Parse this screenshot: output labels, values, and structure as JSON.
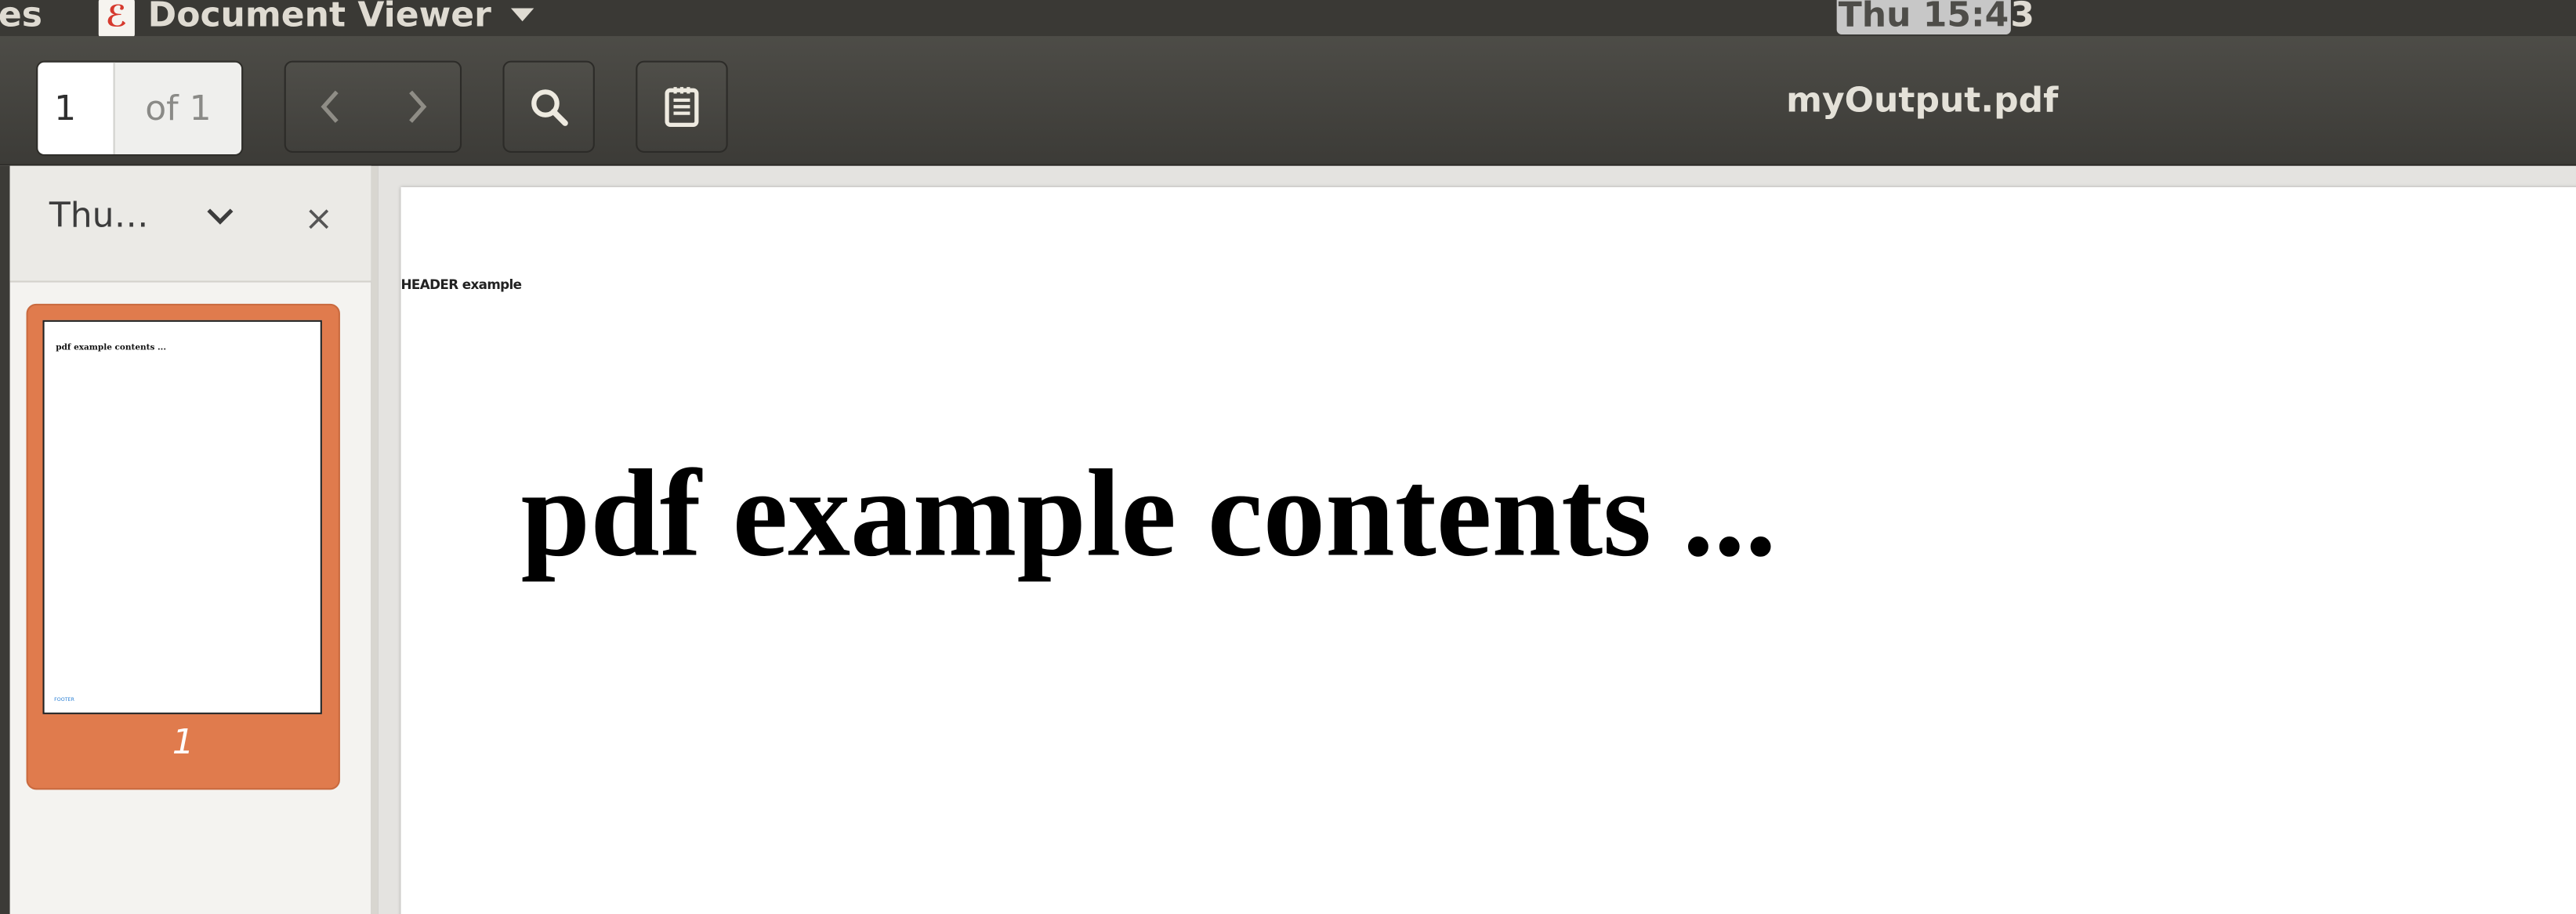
{
  "top_panel": {
    "activities_label": "es",
    "app_icon_glyph": "ℰ",
    "app_name": "Document Viewer",
    "clock_prefix": "Thu 15:4",
    "clock_suffix": "3"
  },
  "toolbar": {
    "page_current": "1",
    "page_total": "of 1",
    "prev_glyph": "‹",
    "next_glyph": "›",
    "search_icon": "search-icon",
    "annotations_icon": "notes-icon"
  },
  "document": {
    "filename": "myOutput.pdf",
    "header_text": "HEADER example",
    "heading": "pdf example contents ..."
  },
  "sidebar": {
    "mode_label": "Thu…",
    "close_glyph": "×",
    "thumbnails": [
      {
        "page_label": "1",
        "preview_text": "pdf example contents ...",
        "footer_text": "FOOTER"
      }
    ]
  },
  "colors": {
    "panel": "#3a3935",
    "header": "#4d4c47",
    "accent": "#e07b4d",
    "sidebar": "#f4f3f0",
    "page": "#ffffff"
  }
}
